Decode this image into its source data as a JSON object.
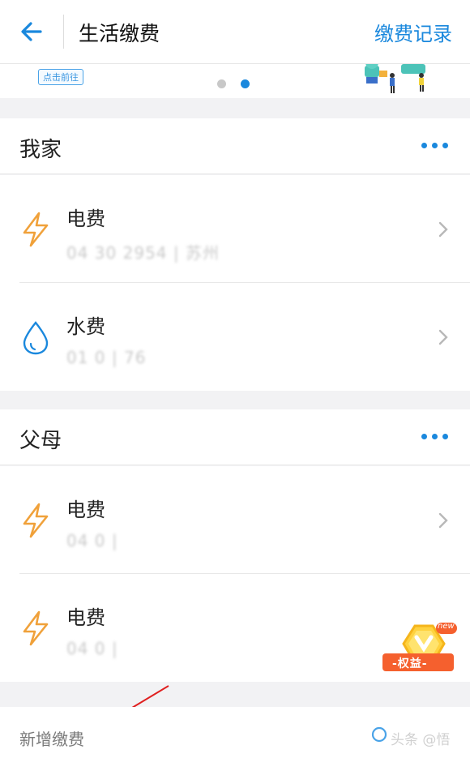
{
  "header": {
    "title": "生活缴费",
    "link": "缴费记录"
  },
  "banner": {
    "button_label": "点击前往",
    "page_count": 2,
    "active_page": 2
  },
  "groups": [
    {
      "title": "我家",
      "items": [
        {
          "name": "电费",
          "account": "04 30  2954 | 苏州",
          "icon": "lightning-icon"
        },
        {
          "name": "水费",
          "account": "01 0  | 76",
          "icon": "water-drop-icon"
        }
      ]
    },
    {
      "title": "父母",
      "items": [
        {
          "name": "电费",
          "account": "04  0  | ",
          "icon": "lightning-icon"
        },
        {
          "name": "电费",
          "account": "04  0  | ",
          "icon": "lightning-icon"
        }
      ]
    }
  ],
  "footer": {
    "add_label": "新增缴费",
    "watermark": "头条 @悟"
  },
  "floating_badge": {
    "tag": "new",
    "label": "-权益-"
  },
  "colors": {
    "accent": "#1a88dd",
    "lightning": "#f0a13a",
    "water": "#1a88dd",
    "annotation_arrow": "#e02020"
  }
}
